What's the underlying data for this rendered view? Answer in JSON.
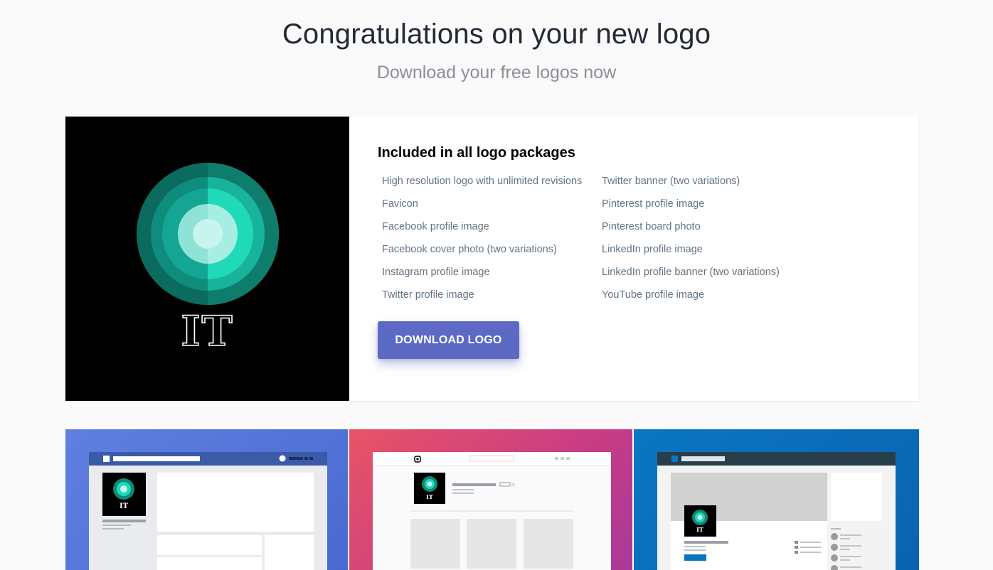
{
  "header": {
    "title": "Congratulations on your new logo",
    "subtitle": "Download your free logos now"
  },
  "logo": {
    "text": "IT",
    "colors": {
      "background": "#000000",
      "ring_outer": "#0c6b5f",
      "ring_accent": "#1fcfb0",
      "core": "#c8f4ee"
    }
  },
  "package": {
    "heading": "Included in all logo packages",
    "features_left": [
      "High resolution logo with unlimited revisions",
      "Favicon",
      "Facebook profile image",
      "Facebook cover photo (two variations)",
      "Instagram profile image",
      "Twitter profile image"
    ],
    "features_right": [
      "Twitter banner (two variations)",
      "Pinterest profile image",
      "Pinterest board photo",
      "LinkedIn profile image",
      "LinkedIn profile banner (two variations)",
      "YouTube profile image"
    ],
    "download_label": "DOWNLOAD LOGO",
    "accent_color": "#5c6ac4"
  },
  "mockups": [
    {
      "platform": "facebook",
      "logo_text": "IT",
      "color": "#4a6ad0"
    },
    {
      "platform": "instagram",
      "logo_text": "IT",
      "color": "#d8466f"
    },
    {
      "platform": "linkedin",
      "logo_text": "IT",
      "color": "#0a6fbc"
    }
  ]
}
